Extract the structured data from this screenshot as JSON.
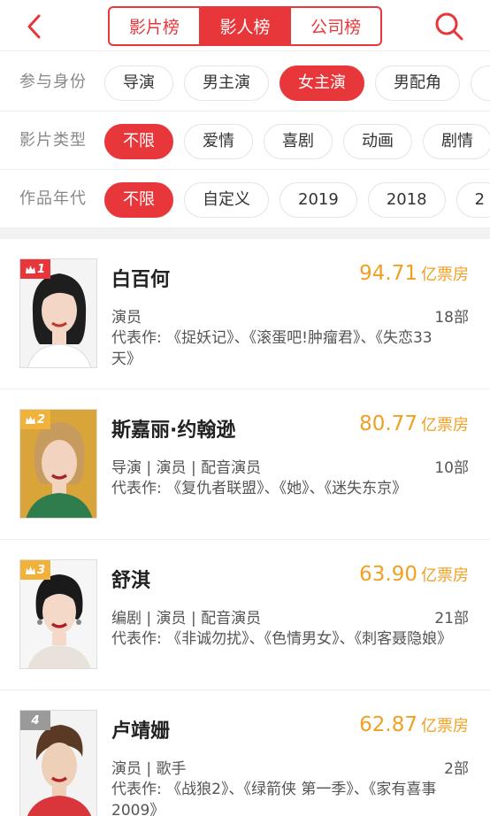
{
  "tabs": [
    {
      "label": "影片榜",
      "active": false
    },
    {
      "label": "影人榜",
      "active": true
    },
    {
      "label": "公司榜",
      "active": false
    }
  ],
  "filters": [
    {
      "label": "参与身份",
      "options": [
        "导演",
        "男主演",
        "女主演",
        "男配角"
      ],
      "selected": "女主演"
    },
    {
      "label": "影片类型",
      "options": [
        "不限",
        "爱情",
        "喜剧",
        "动画",
        "剧情"
      ],
      "selected": "不限"
    },
    {
      "label": "作品年代",
      "options": [
        "不限",
        "自定义",
        "2019",
        "2018",
        "2"
      ],
      "selected": "不限"
    }
  ],
  "people": [
    {
      "rank": "1",
      "name": "白百何",
      "box_office": "94.71",
      "unit": "亿票房",
      "roles": "演员",
      "film_count": "18部",
      "works": "代表作: 《捉妖记》、《滚蛋吧!肿瘤君》、《失恋33天》"
    },
    {
      "rank": "2",
      "name": "斯嘉丽·约翰逊",
      "box_office": "80.77",
      "unit": "亿票房",
      "roles": "导演 | 演员 | 配音演员",
      "film_count": "10部",
      "works": "代表作: 《复仇者联盟》、《她》、《迷失东京》"
    },
    {
      "rank": "3",
      "name": "舒淇",
      "box_office": "63.90",
      "unit": "亿票房",
      "roles": "编剧 | 演员 | 配音演员",
      "film_count": "21部",
      "works": "代表作: 《非诚勿扰》、《色情男女》、《刺客聂隐娘》"
    },
    {
      "rank": "4",
      "name": "卢靖姗",
      "box_office": "62.87",
      "unit": "亿票房",
      "roles": "演员 | 歌手",
      "film_count": "2部",
      "works": "代表作: 《战狼2》、《绿箭侠 第一季》、《家有喜事2009》"
    }
  ],
  "colors": {
    "accent": "#e8373a",
    "box_office": "#f0a023",
    "rank_gold": "#f0b23a",
    "rank_gray": "#9a9a9a"
  }
}
